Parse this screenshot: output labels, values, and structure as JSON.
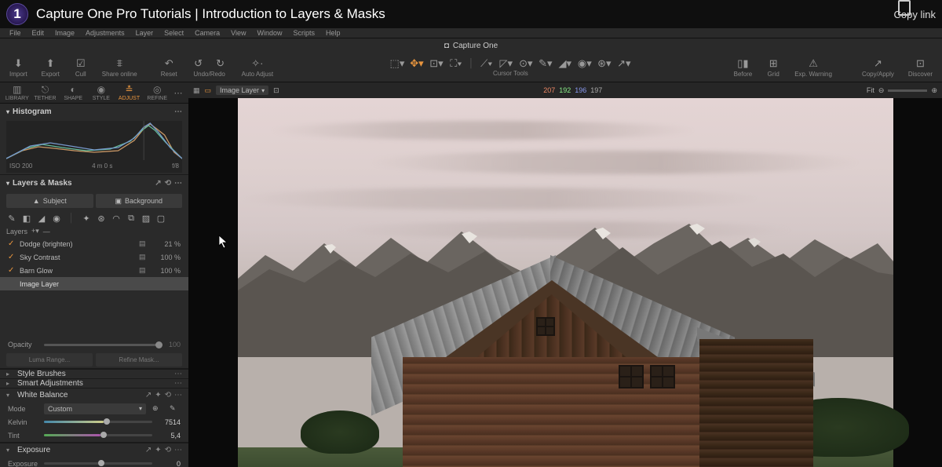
{
  "youtube": {
    "title": "Capture One Pro Tutorials | Introduction to Layers & Masks",
    "logo": "1",
    "copy": "Copy link"
  },
  "menubar": {
    "items": [
      "File",
      "Edit",
      "Image",
      "Adjustments",
      "Layer",
      "Select",
      "Camera",
      "View",
      "Window",
      "Scripts",
      "Help"
    ]
  },
  "app": {
    "title": "Capture One",
    "doc_icon": "◻"
  },
  "toolbar": {
    "left": [
      {
        "icons": [
          "⬇"
        ],
        "label": "Import"
      },
      {
        "icons": [
          "⬆"
        ],
        "label": "Export"
      },
      {
        "icons": [
          "☑"
        ],
        "label": "Cull"
      },
      {
        "icons": [
          "⩨"
        ],
        "label": "Share online"
      },
      {
        "icons": [
          "↶"
        ],
        "label": "Reset"
      },
      {
        "icons": [
          "↺",
          "↻"
        ],
        "label": "Undo/Redo"
      },
      {
        "icons": [
          "✧"
        ],
        "label": "Auto Adjust"
      }
    ],
    "center_label": "Cursor Tools",
    "right": [
      {
        "icons": [
          "▭"
        ],
        "label": "Before"
      },
      {
        "icons": [
          "⊞"
        ],
        "label": "Grid"
      },
      {
        "icons": [
          "⚠"
        ],
        "label": "Exp. Warning"
      },
      {
        "icons": [
          "↗"
        ],
        "label": "Copy/Apply"
      },
      {
        "icons": [
          "⊡"
        ],
        "label": "Discover"
      }
    ]
  },
  "tool_tabs": [
    {
      "icon": "▥",
      "label": "LIBRARY"
    },
    {
      "icon": "⎋",
      "label": "TETHER"
    },
    {
      "icon": "◐",
      "label": "SHAPE"
    },
    {
      "icon": "◉",
      "label": "STYLE"
    },
    {
      "icon": "≛",
      "label": "ADJUST",
      "active": true
    },
    {
      "icon": "◎",
      "label": "REFINE"
    }
  ],
  "histogram": {
    "title": "Histogram",
    "iso": "ISO 200",
    "shutter": "4 m 0 s",
    "aperture": "f/8"
  },
  "layers_masks": {
    "title": "Layers & Masks",
    "subject": "Subject",
    "background": "Background",
    "layers_label": "Layers",
    "layers": [
      {
        "on": true,
        "name": "Dodge (brighten)",
        "opacity": "21 %"
      },
      {
        "on": true,
        "name": "Sky Contrast",
        "opacity": "100 %"
      },
      {
        "on": true,
        "name": "Barn Glow",
        "opacity": "100 %"
      },
      {
        "on": false,
        "name": "Image Layer",
        "opacity": "",
        "sel": true
      }
    ],
    "opacity_label": "Opacity",
    "opacity_val": "100",
    "luma": "Luma Range...",
    "refine": "Refine Mask..."
  },
  "panels": [
    {
      "title": "Style Brushes",
      "open": false
    },
    {
      "title": "Smart Adjustments",
      "open": false
    }
  ],
  "white_balance": {
    "title": "White Balance",
    "mode_lbl": "Mode",
    "mode_val": "Custom",
    "kelvin_lbl": "Kelvin",
    "kelvin_val": "7514",
    "tint_lbl": "Tint",
    "tint_val": "5,4"
  },
  "exposure": {
    "title": "Exposure",
    "exp_lbl": "Exposure",
    "exp_val": "0"
  },
  "viewer": {
    "layer_sel": "Image Layer",
    "rgb": {
      "r": "207",
      "g": "192",
      "b": "196",
      "k": "197"
    },
    "fit": "Fit"
  }
}
